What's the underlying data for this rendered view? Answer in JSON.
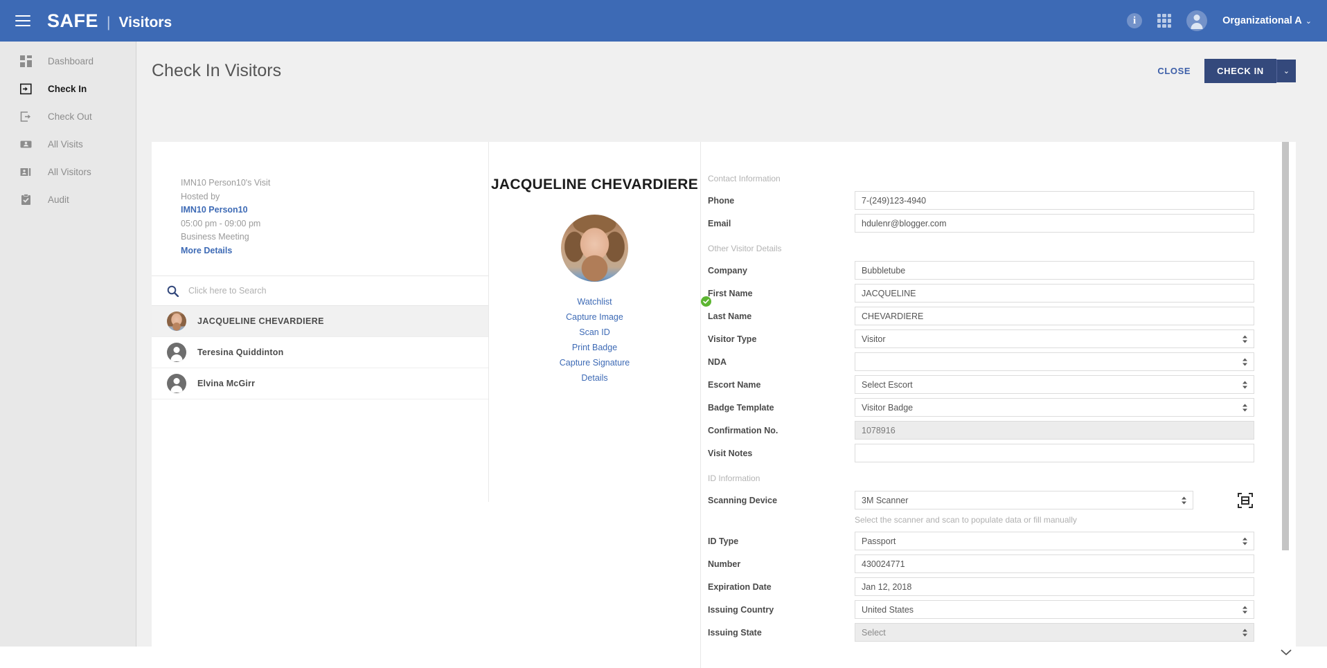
{
  "topbar": {
    "menu_icon": "hamburger-icon",
    "brand": "SAFE",
    "separator": "|",
    "app_name": "Visitors",
    "info_icon": "i",
    "apps_icon": "grid-icon",
    "account_name": "Organizational A",
    "account_caret": "⌄"
  },
  "sidebar": {
    "items": [
      {
        "label": "Dashboard",
        "icon": "dashboard-icon",
        "active": false
      },
      {
        "label": "Check In",
        "icon": "check-in-icon",
        "active": true
      },
      {
        "label": "Check Out",
        "icon": "check-out-icon",
        "active": false
      },
      {
        "label": "All Visits",
        "icon": "all-visits-icon",
        "active": false
      },
      {
        "label": "All Visitors",
        "icon": "all-visitors-icon",
        "active": false
      },
      {
        "label": "Audit",
        "icon": "audit-icon",
        "active": false
      }
    ]
  },
  "page": {
    "title": "Check In Visitors",
    "close_label": "CLOSE",
    "checkin_label": "CHECK IN",
    "checkin_caret": "⌄"
  },
  "visit": {
    "title": "IMN10 Person10's Visit",
    "hosted_by_label": "Hosted by",
    "host_name": "IMN10 Person10",
    "time_range": "05:00 pm - 09:00 pm",
    "purpose": "Business Meeting",
    "more_details": "More Details"
  },
  "search": {
    "placeholder": "Click here to Search",
    "value": "",
    "icon": "search-icon"
  },
  "visitor_list": [
    {
      "name": "JACQUELINE CHEVARDIERE",
      "selected": true,
      "avatar": "photo"
    },
    {
      "name": "Teresina Quiddinton",
      "selected": false,
      "avatar": "person"
    },
    {
      "name": "Elvina McGirr",
      "selected": false,
      "avatar": "person"
    }
  ],
  "visitor_detail": {
    "name": "JACQUELINE CHEVARDIERE",
    "photo": "visitor-photo",
    "actions": [
      {
        "label": "Watchlist",
        "status": "passed"
      },
      {
        "label": "Capture Image",
        "status": ""
      },
      {
        "label": "Scan ID",
        "status": ""
      },
      {
        "label": "Print Badge",
        "status": ""
      },
      {
        "label": "Capture Signature",
        "status": ""
      },
      {
        "label": "Details",
        "status": ""
      }
    ],
    "watchlist_check_color": "#5cb531"
  },
  "form": {
    "contact_section": "Contact Information",
    "phone_label": "Phone",
    "phone_value": "7-(249)123-4940",
    "email_label": "Email",
    "email_value": "hdulenr@blogger.com",
    "other_section": "Other Visitor Details",
    "company_label": "Company",
    "company_value": "Bubbletube",
    "first_name_label": "First Name",
    "first_name_value": "JACQUELINE",
    "last_name_label": "Last Name",
    "last_name_value": "CHEVARDIERE",
    "visitor_type_label": "Visitor Type",
    "visitor_type_value": "Visitor",
    "nda_label": "NDA",
    "nda_value": "",
    "escort_label": "Escort Name",
    "escort_value": "Select Escort",
    "badge_template_label": "Badge Template",
    "badge_template_value": "Visitor Badge",
    "confirmation_label": "Confirmation No.",
    "confirmation_value": "1078916",
    "visit_notes_label": "Visit Notes",
    "visit_notes_value": "",
    "id_section": "ID Information",
    "scanning_device_label": "Scanning Device",
    "scanning_device_value": "3M Scanner",
    "scan_icon": "barcode-scan-icon",
    "scanner_help": "Select the scanner and scan to populate data or fill manually",
    "id_type_label": "ID Type",
    "id_type_value": "Passport",
    "number_label": "Number",
    "number_value": "430024771",
    "expiration_label": "Expiration Date",
    "expiration_value": "Jan 12, 2018",
    "country_label": "Issuing Country",
    "country_value": "United States",
    "state_label": "Issuing State",
    "state_value": "Select"
  },
  "colors": {
    "brand_blue": "#3d6ab5",
    "button_navy": "#34497c",
    "link_blue": "#3d6ab5",
    "success_green": "#5cb531"
  }
}
